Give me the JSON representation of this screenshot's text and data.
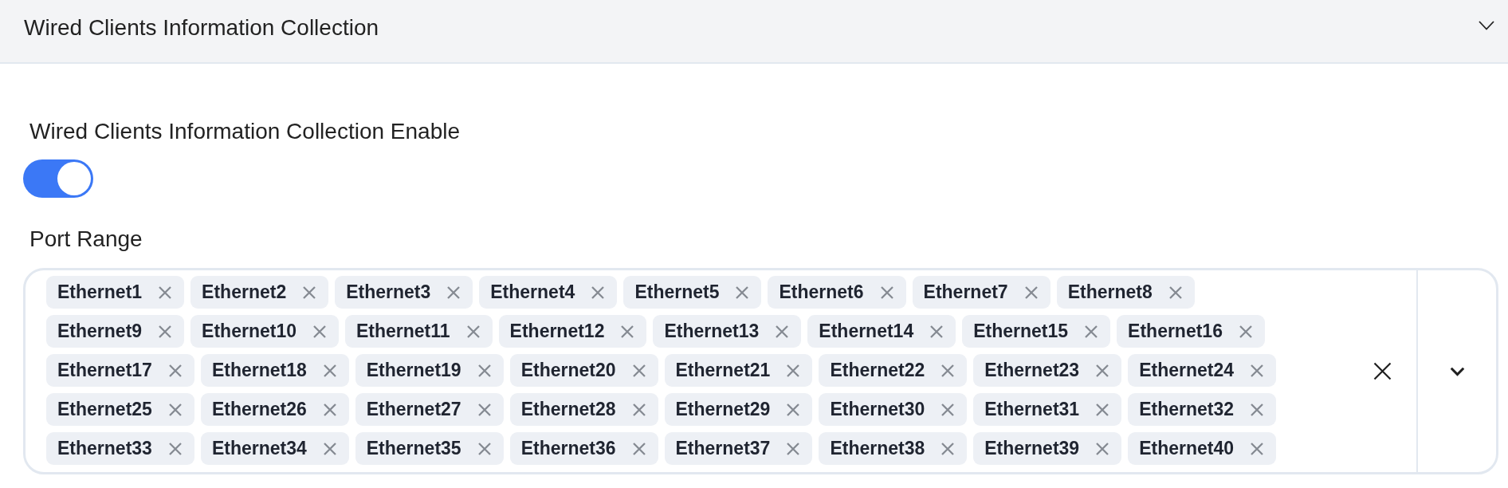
{
  "section": {
    "title": "Wired Clients Information Collection",
    "expanded": true
  },
  "collection_enable": {
    "label": "Wired Clients Information Collection Enable",
    "on": true
  },
  "port_range": {
    "label": "Port Range",
    "tags": [
      "Ethernet1",
      "Ethernet2",
      "Ethernet3",
      "Ethernet4",
      "Ethernet5",
      "Ethernet6",
      "Ethernet7",
      "Ethernet8",
      "Ethernet9",
      "Ethernet10",
      "Ethernet11",
      "Ethernet12",
      "Ethernet13",
      "Ethernet14",
      "Ethernet15",
      "Ethernet16",
      "Ethernet17",
      "Ethernet18",
      "Ethernet19",
      "Ethernet20",
      "Ethernet21",
      "Ethernet22",
      "Ethernet23",
      "Ethernet24",
      "Ethernet25",
      "Ethernet26",
      "Ethernet27",
      "Ethernet28",
      "Ethernet29",
      "Ethernet30",
      "Ethernet31",
      "Ethernet32",
      "Ethernet33",
      "Ethernet34",
      "Ethernet35",
      "Ethernet36",
      "Ethernet37",
      "Ethernet38",
      "Ethernet39",
      "Ethernet40"
    ]
  }
}
